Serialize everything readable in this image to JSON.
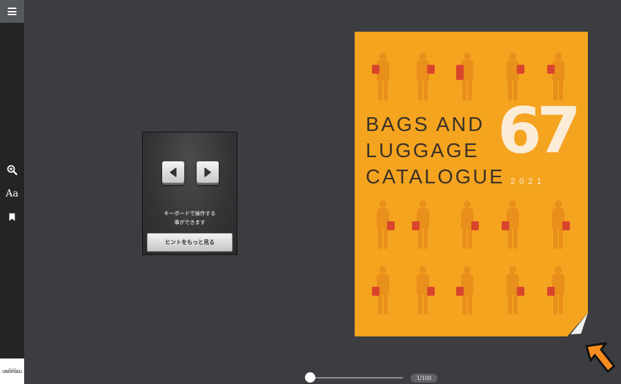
{
  "sidebar": {
    "menu_icon": "hamburger-menu-icon",
    "tools": [
      {
        "name": "zoom-in",
        "icon": "zoom-in-icon"
      },
      {
        "name": "text-size",
        "icon": "text-size-icon",
        "label": "Aa"
      },
      {
        "name": "bookmark",
        "icon": "bookmark-icon"
      }
    ],
    "logo": {
      "top_text": "DESIGN",
      "brand": "UNOPSEU"
    }
  },
  "hint_popup": {
    "left_key_icon": "arrow-left-key-icon",
    "right_key_icon": "arrow-right-key-icon",
    "message": "キーボードで操作する\n事ができます",
    "button_label": "ヒントをもっと見る"
  },
  "catalogue": {
    "title": "BAGS AND\nLUGGAGE\nCATALOGUE",
    "number": "67",
    "year": "2021",
    "background_color": "#f5a41f",
    "accent_color": "#d9452c"
  },
  "viewer": {
    "next_arrow_icon": "orange-arrow-icon",
    "page_curl_icon": "page-curl-icon",
    "page_indicator": "1/100",
    "current_page": 1,
    "total_pages": 100
  }
}
